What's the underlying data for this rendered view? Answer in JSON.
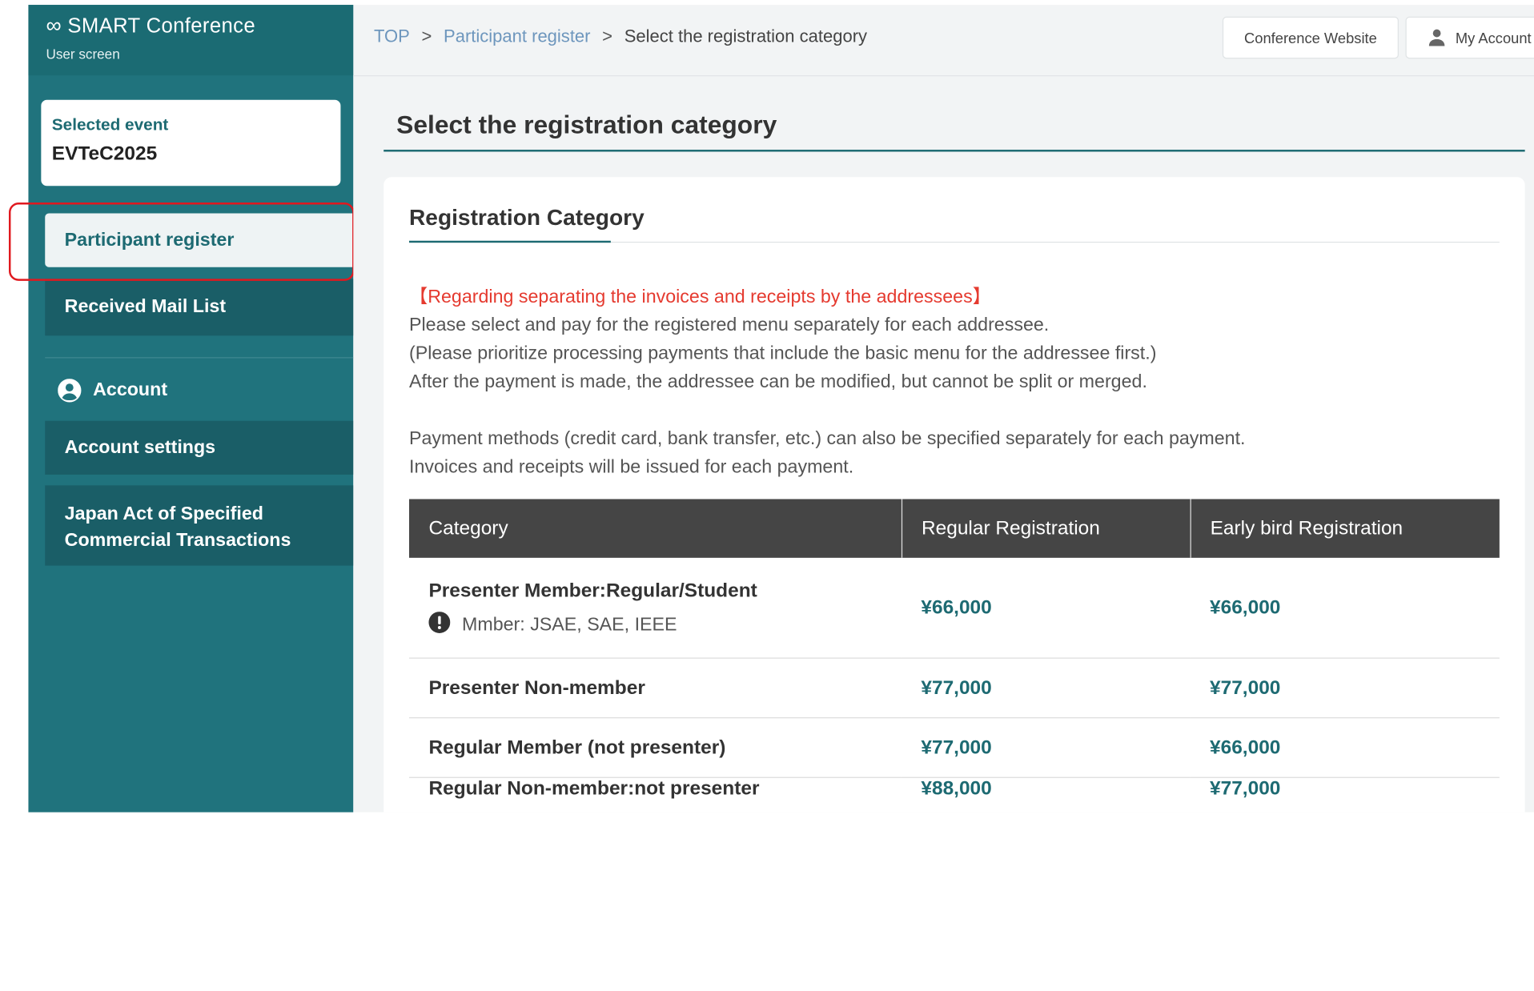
{
  "app": {
    "brand": "SMART Conference",
    "subtitle": "User screen"
  },
  "sidebar": {
    "selected_event_label": "Selected event",
    "selected_event_value": "EVTeC2025",
    "items": [
      {
        "label": "Participant register",
        "active": true
      },
      {
        "label": "Received Mail List",
        "active": false
      }
    ],
    "account_heading": "Account",
    "account_items": [
      {
        "label": "Account settings"
      },
      {
        "label": "Japan Act of Specified Commercial Transactions"
      }
    ]
  },
  "header": {
    "breadcrumb": [
      "TOP",
      "Participant register",
      "Select the registration category"
    ],
    "conference_website_button": "Conference Website",
    "my_account_button": "My Account"
  },
  "main": {
    "page_title": "Select the registration category",
    "card_title": "Registration Category",
    "notice_title": "【Regarding separating the invoices and receipts by the addressees】",
    "notice_lines": [
      "Please select and pay for the registered menu separately for each addressee.",
      "(Please prioritize processing payments that include the basic menu for the addressee first.)",
      "After the payment is made, the addressee can be modified, but cannot be split or merged."
    ],
    "notice_lines_2": [
      "Payment methods (credit card, bank transfer, etc.) can also be specified separately for each payment.",
      "Invoices and receipts will be issued for each payment."
    ],
    "table": {
      "headers": [
        "Category",
        "Regular Registration",
        "Early bird Registration"
      ],
      "rows": [
        {
          "category": "Presenter Member:Regular/Student",
          "note": "Mmber: JSAE, SAE, IEEE",
          "regular": "¥66,000",
          "early": "¥66,000"
        },
        {
          "category": "Presenter Non-member",
          "regular": "¥77,000",
          "early": "¥77,000"
        },
        {
          "category": "Regular Member (not presenter)",
          "regular": "¥77,000",
          "early": "¥66,000"
        },
        {
          "category": "Regular Non-member:not presenter",
          "regular": "¥88,000",
          "early": "¥77,000"
        }
      ]
    }
  },
  "colors": {
    "sidebar": "#20737d",
    "accent": "#1d6a72",
    "notice_red": "#e53a2f",
    "table_header": "#454545",
    "highlight_outline": "#e0191f"
  }
}
